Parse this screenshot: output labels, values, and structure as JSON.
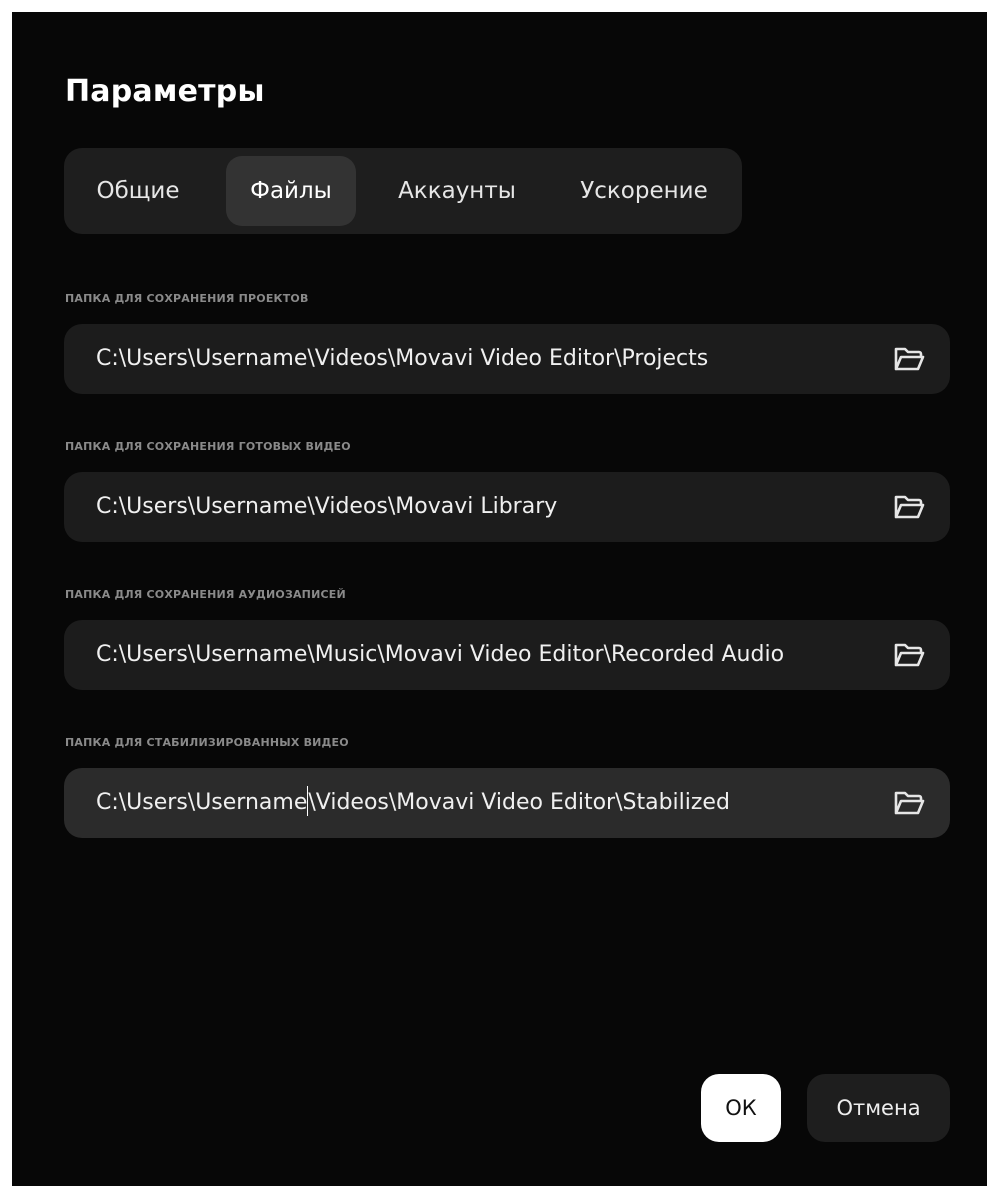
{
  "dialog": {
    "title": "Параметры"
  },
  "tabs": [
    {
      "label": "Общие",
      "active": false
    },
    {
      "label": "Файлы",
      "active": true
    },
    {
      "label": "Аккаунты",
      "active": false
    },
    {
      "label": "Ускорение",
      "active": false
    }
  ],
  "sections": [
    {
      "label": "ПАПКА ДЛЯ СОХРАНЕНИЯ ПРОЕКТОВ",
      "path": "C:\\Users\\Username\\Videos\\Movavi Video Editor\\Projects",
      "icon": "folder-open-icon"
    },
    {
      "label": "ПАПКА ДЛЯ СОХРАНЕНИЯ ГОТОВЫХ ВИДЕО",
      "path": "C:\\Users\\Username\\Videos\\Movavi Library",
      "icon": "folder-open-icon"
    },
    {
      "label": "ПАПКА ДЛЯ СОХРАНЕНИЯ АУДИОЗАПИСЕЙ",
      "path": "C:\\Users\\Username\\Music\\Movavi Video Editor\\Recorded Audio",
      "icon": "folder-open-icon"
    },
    {
      "label": "ПАПКА ДЛЯ СТАБИЛИЗИРОВАННЫХ ВИДЕО",
      "path_before_caret": "C:\\Users\\Username",
      "path_after_caret": "\\Videos\\Movavi Video Editor\\Stabilized",
      "icon": "folder-open-icon",
      "focused": true
    }
  ],
  "footer": {
    "ok_label": "ОК",
    "cancel_label": "Отмена"
  },
  "colors": {
    "background": "#070707",
    "field": "#1c1c1c",
    "field_focused": "#2b2b2b",
    "tab_active": "#333333",
    "section_label": "#8a8a8a",
    "primary_button": "#ffffff"
  }
}
